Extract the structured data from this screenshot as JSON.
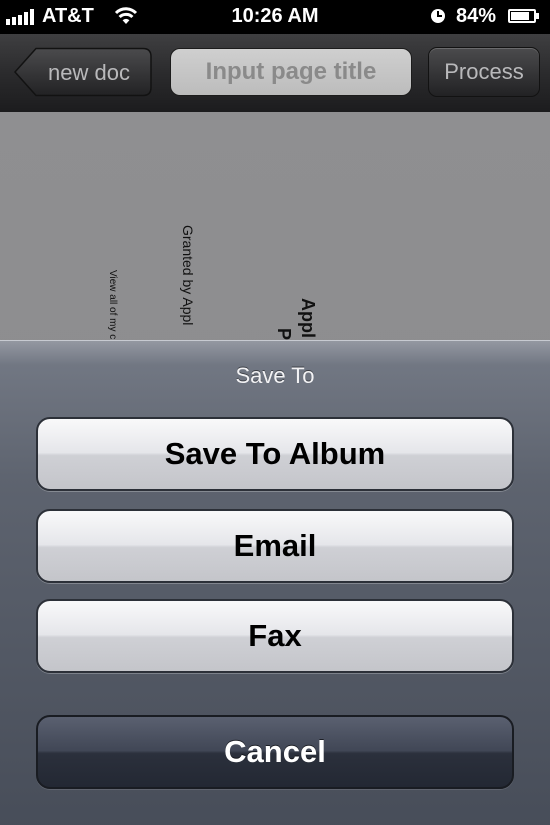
{
  "status_bar": {
    "carrier": "AT&T",
    "time": "10:26 AM",
    "battery_percent": "84%",
    "battery_level": 0.84,
    "signal_bars": 5
  },
  "nav_bar": {
    "back_label": "new doc",
    "title_placeholder": "Input page title",
    "process_label": "Process"
  },
  "document": {
    "line1": "View all of my c",
    "line2": "Granted by Appl",
    "line3": "Appl",
    "line4": "P"
  },
  "action_sheet": {
    "title": "Save To",
    "buttons": [
      {
        "label": "Save To Album"
      },
      {
        "label": "Email"
      },
      {
        "label": "Fax"
      }
    ],
    "cancel_label": "Cancel"
  },
  "colors": {
    "sheet_button_text": "#000000",
    "cancel_text": "#ffffff",
    "nav_text": "#b9b9bb"
  }
}
